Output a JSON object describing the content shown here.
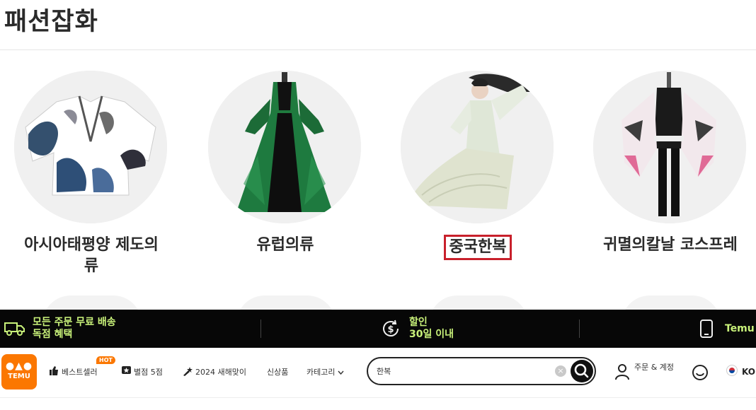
{
  "section": {
    "title": "패션잡화"
  },
  "categories": [
    {
      "label": "아시아태평양 제도의\n류",
      "icon": "kimono-jacket-image",
      "highlighted": false
    },
    {
      "label": "유럽의류",
      "icon": "victorian-dress-image",
      "highlighted": false
    },
    {
      "label": "중국한복",
      "icon": "hanfu-image",
      "highlighted": true
    },
    {
      "label": "귀멸의칼날 코스프레",
      "icon": "cosplay-costume-image",
      "highlighted": false
    }
  ],
  "promo_bar": {
    "shipping_line1": "모든 주문 무료 배송",
    "shipping_line2": "독점 혜택",
    "discount_line1": "할인",
    "discount_line2": "30일 이내",
    "app_text": "Temu",
    "icons": [
      "truck-icon",
      "dollar-refresh-icon",
      "phone-icon"
    ]
  },
  "header": {
    "logo_text": "TEMU",
    "nav": {
      "bestseller": "베스트셀러",
      "hot_badge": "HOT",
      "rating": "별점 5점",
      "new_year": "2024 새해맞이",
      "new_arrivals": "신상품",
      "category": "카테고리"
    },
    "search": {
      "value": "한복",
      "placeholder": ""
    },
    "account": "주문 & 계정",
    "language": "KO"
  },
  "colors": {
    "brand_orange": "#fb7701",
    "promo_bg": "#070707",
    "promo_text": "#c9f27a",
    "highlight_red": "#c8202b"
  }
}
